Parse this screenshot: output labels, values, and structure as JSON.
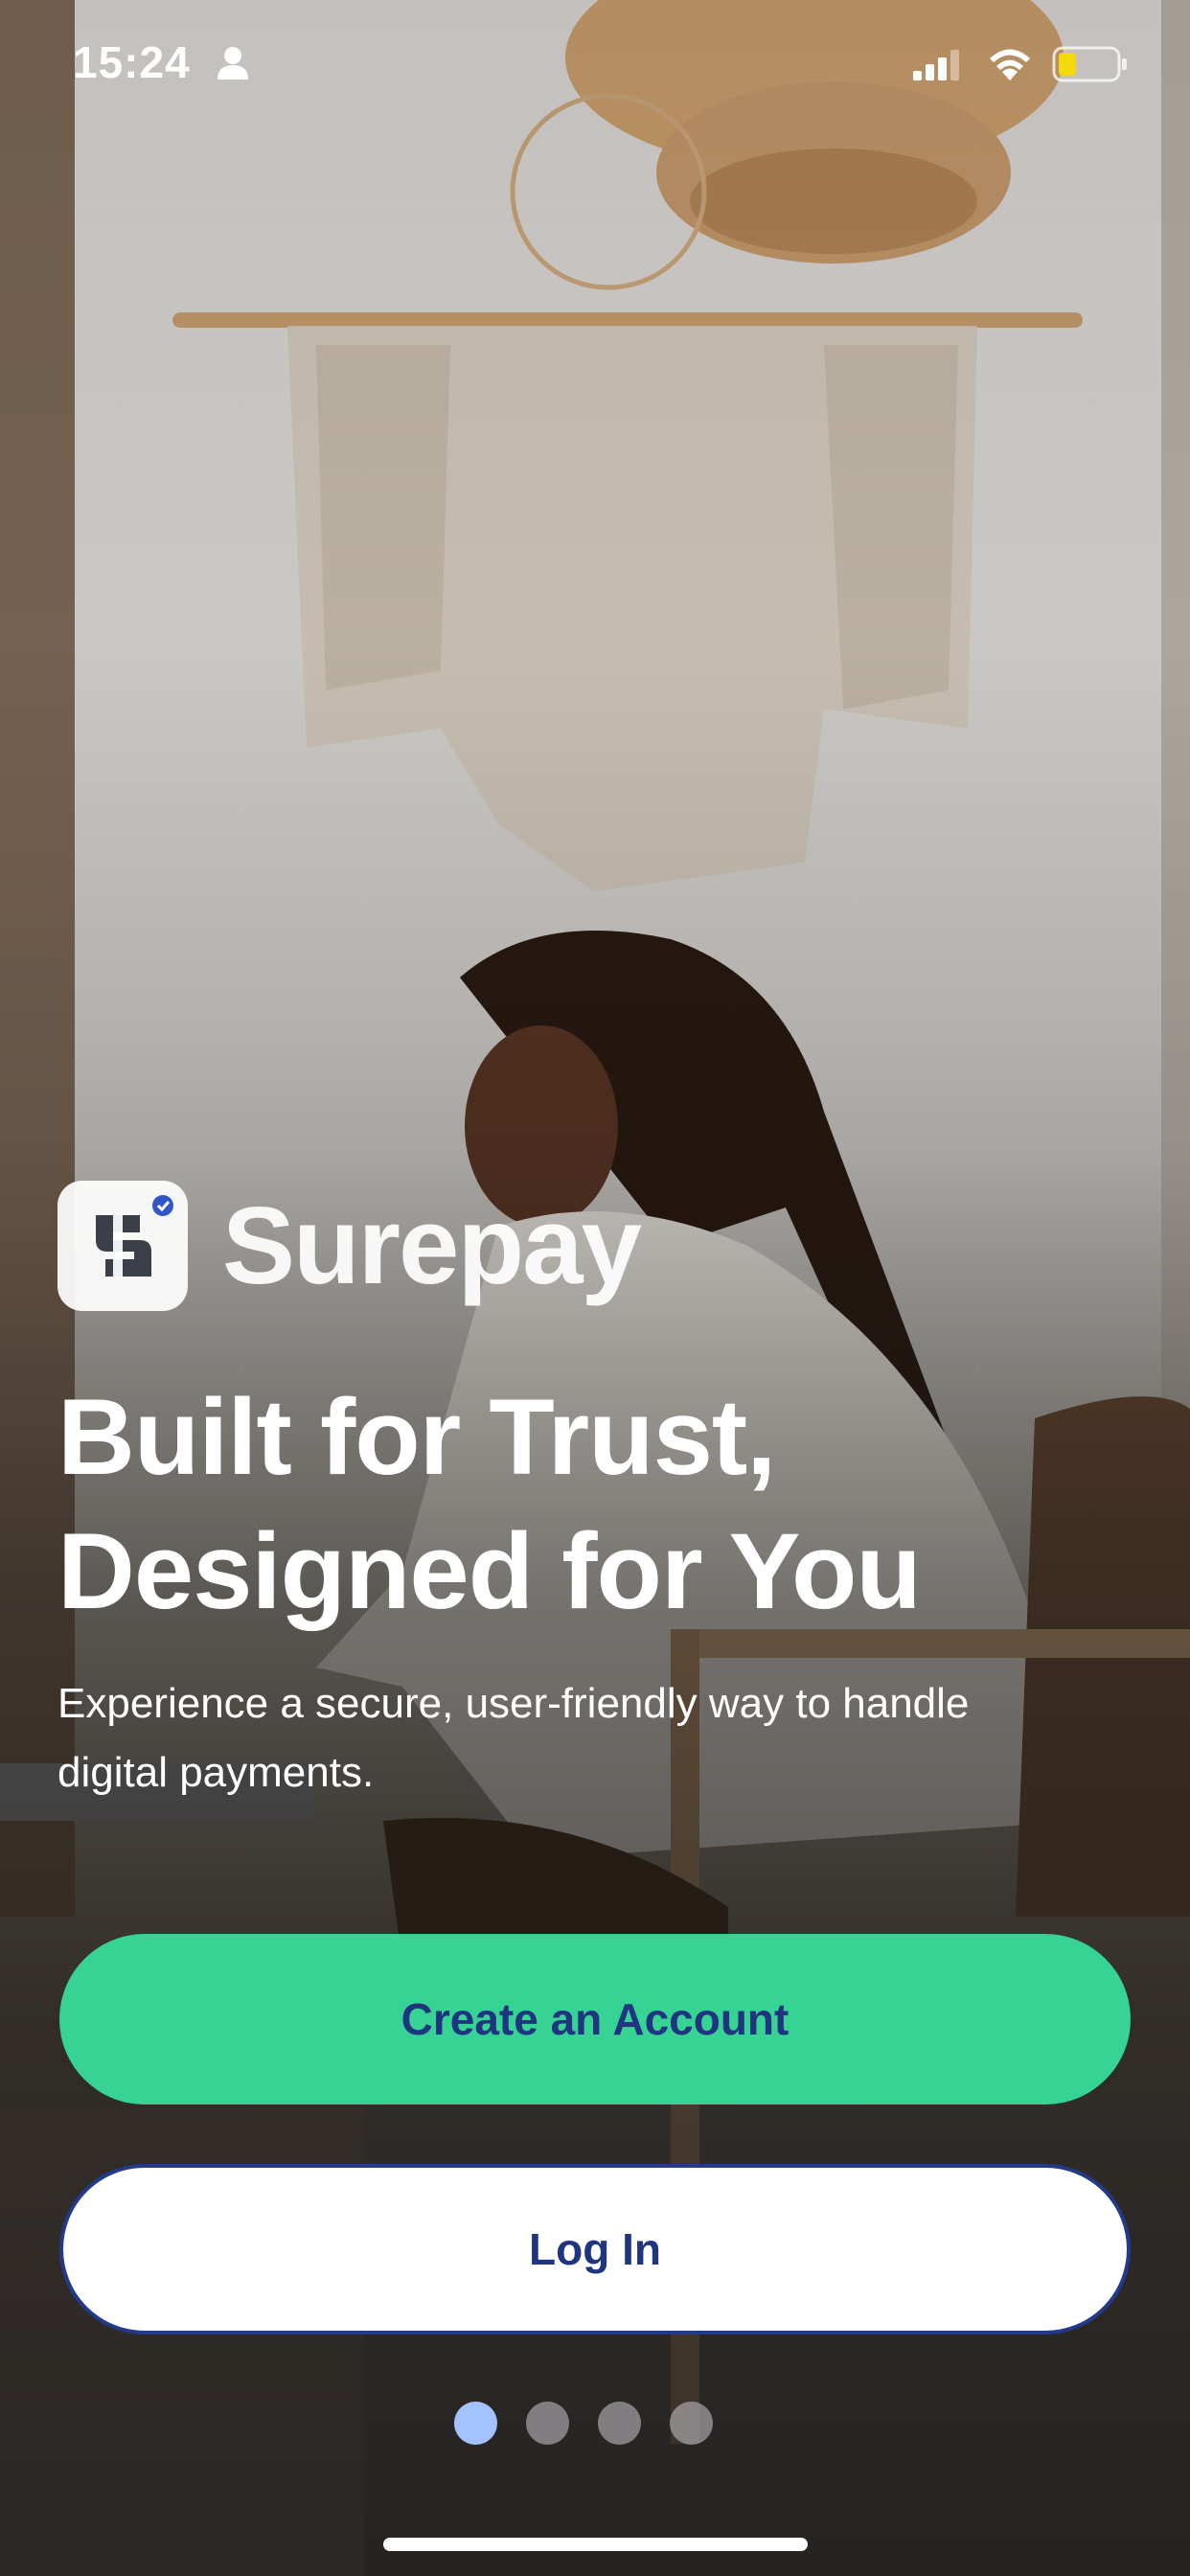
{
  "status_bar": {
    "time": "15:24",
    "icons": [
      "person-icon",
      "cellular-signal-icon",
      "wifi-icon",
      "battery-icon"
    ],
    "battery_color": "#f5d90a"
  },
  "brand": {
    "name": "Surepay",
    "logo_icon": "surepay-logo-icon"
  },
  "hero": {
    "headline_line1": "Built for Trust,",
    "headline_line2": "Designed for You",
    "subtitle": "Experience a secure, user-friendly way to handle digital payments."
  },
  "actions": {
    "create_account_label": "Create an Account",
    "login_label": "Log In"
  },
  "pager": {
    "total": 4,
    "active_index": 0
  },
  "colors": {
    "primary_button": "#36d394",
    "button_text": "#1f3580",
    "secondary_border": "#233a8a",
    "active_dot": "#a3c2ff"
  }
}
